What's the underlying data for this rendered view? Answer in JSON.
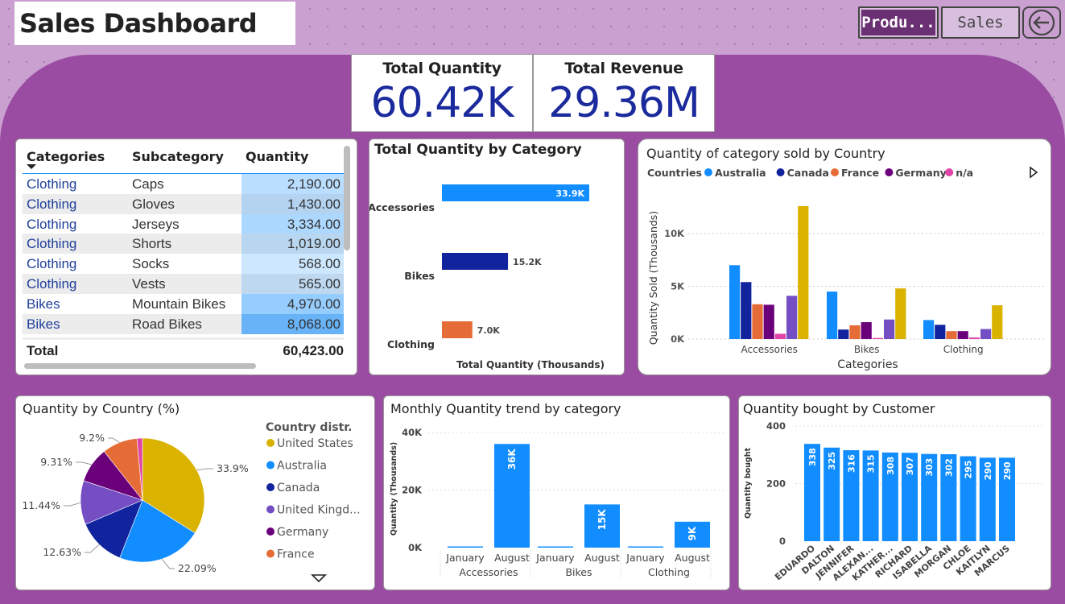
{
  "header": {
    "title": "Sales Dashboard",
    "nav_products": "Produ...",
    "nav_sales": "Sales",
    "back_icon": "arrow-left-circle-icon"
  },
  "kpis": {
    "total_quantity_label": "Total Quantity",
    "total_quantity_value": "60.42K",
    "total_revenue_label": "Total Revenue",
    "total_revenue_value": "29.36M"
  },
  "table": {
    "headers": [
      "Categories",
      "Subcategory",
      "Quantity"
    ],
    "rows": [
      {
        "category": "Clothing",
        "subcategory": "Caps",
        "quantity": "2,190.00",
        "level": 0.27
      },
      {
        "category": "Clothing",
        "subcategory": "Gloves",
        "quantity": "1,430.00",
        "level": 0.18
      },
      {
        "category": "Clothing",
        "subcategory": "Jerseys",
        "quantity": "3,334.00",
        "level": 0.41
      },
      {
        "category": "Clothing",
        "subcategory": "Shorts",
        "quantity": "1,019.00",
        "level": 0.13
      },
      {
        "category": "Clothing",
        "subcategory": "Socks",
        "quantity": "568.00",
        "level": 0.07
      },
      {
        "category": "Clothing",
        "subcategory": "Vests",
        "quantity": "565.00",
        "level": 0.07
      },
      {
        "category": "Bikes",
        "subcategory": "Mountain Bikes",
        "quantity": "4,970.00",
        "level": 0.62
      },
      {
        "category": "Bikes",
        "subcategory": "Road Bikes",
        "quantity": "8,068.00",
        "level": 1.0
      }
    ],
    "total_label": "Total",
    "total_value": "60,423.00"
  },
  "colors": {
    "australia": "#118dff",
    "canada": "#12239e",
    "france": "#e66c37",
    "germany": "#6b007b",
    "na": "#e044a7",
    "united_states": "#d9b300",
    "uk": "#744ec2",
    "panel_purple": "#9a4ca2",
    "kpi_blue": "#1b2a9c"
  },
  "chart_data": [
    {
      "type": "bar",
      "orientation": "horizontal",
      "title": "Total Quantity by Category",
      "categories": [
        "Accessories",
        "Bikes",
        "Clothing"
      ],
      "values": [
        33.9,
        15.2,
        7.0
      ],
      "data_labels": [
        "33.9K",
        "15.2K",
        "7.0K"
      ],
      "xlabel": "Total Quantity (Thousands)",
      "colors": [
        "#118dff",
        "#12239e",
        "#e66c37"
      ]
    },
    {
      "type": "bar",
      "title": "Quantity of category sold by Country",
      "legend_title": "Countries",
      "legend_position": "top",
      "categories": [
        "Accessories",
        "Bikes",
        "Clothing"
      ],
      "xlabel": "Categories",
      "ylabel": "Quantity Sold (Thousands)",
      "yticks": [
        "0K",
        "5K",
        "10K"
      ],
      "ylim": [
        0,
        13000
      ],
      "series": [
        {
          "name": "Australia",
          "color": "#118dff",
          "values": [
            7000,
            4500,
            1800
          ]
        },
        {
          "name": "Canada",
          "color": "#12239e",
          "values": [
            5400,
            900,
            1350
          ]
        },
        {
          "name": "France",
          "color": "#e66c37",
          "values": [
            3300,
            1300,
            750
          ]
        },
        {
          "name": "Germany",
          "color": "#6b007b",
          "values": [
            3250,
            1600,
            750
          ]
        },
        {
          "name": "n/a",
          "color": "#e044a7",
          "values": [
            500,
            100,
            150
          ]
        },
        {
          "name": "",
          "color": "#744ec2",
          "values": [
            4100,
            1850,
            950
          ]
        },
        {
          "name": "",
          "color": "#d9b300",
          "values": [
            12600,
            4800,
            3200
          ]
        }
      ]
    },
    {
      "type": "pie",
      "title": "Quantity by Country (%)",
      "legend_title": "Country distr.",
      "slices": [
        {
          "name": "United States",
          "value": 33.9,
          "label": "33.9%",
          "color": "#d9b300"
        },
        {
          "name": "Australia",
          "value": 22.09,
          "label": "22.09%",
          "color": "#118dff"
        },
        {
          "name": "Canada",
          "value": 12.63,
          "label": "12.63%",
          "color": "#12239e"
        },
        {
          "name": "United Kingd...",
          "value": 11.44,
          "label": "11.44%",
          "color": "#744ec2"
        },
        {
          "name": "Germany",
          "value": 9.31,
          "label": "9.31%",
          "color": "#6b007b"
        },
        {
          "name": "France",
          "value": 9.2,
          "label": "9.2%",
          "color": "#e66c37"
        },
        {
          "name": "",
          "value": 1.43,
          "label": "",
          "color": "#e044a7"
        }
      ]
    },
    {
      "type": "bar",
      "title": "Monthly Quantity trend by category",
      "ylabel": "Quantity (Thousands)",
      "yticks": [
        "0K",
        "20K",
        "40K"
      ],
      "ylim": [
        0,
        40000
      ],
      "groups": [
        {
          "name": "Accessories",
          "months": [
            "January",
            "August"
          ],
          "values": [
            300,
            36000
          ],
          "labels": [
            "",
            "36K"
          ]
        },
        {
          "name": "Bikes",
          "months": [
            "January",
            "August"
          ],
          "values": [
            300,
            15000
          ],
          "labels": [
            "",
            "15K"
          ]
        },
        {
          "name": "Clothing",
          "months": [
            "January",
            "August"
          ],
          "values": [
            300,
            9000
          ],
          "labels": [
            "",
            "9K"
          ]
        }
      ],
      "color": "#118dff"
    },
    {
      "type": "bar",
      "title": "Quantity bought by Customer",
      "ylabel": "Quantity bought",
      "yticks": [
        "0",
        "200",
        "400"
      ],
      "ylim": [
        0,
        400
      ],
      "categories": [
        "EDUARDO",
        "DALTON",
        "JENNIFER",
        "ALEXAN...",
        "KATHER...",
        "RICHARD",
        "ISABELLA",
        "MORGAN",
        "CHLOE",
        "KAITLYN",
        "MARCUS"
      ],
      "values": [
        338,
        325,
        316,
        315,
        308,
        307,
        303,
        302,
        295,
        290,
        290
      ],
      "color": "#118dff"
    }
  ]
}
